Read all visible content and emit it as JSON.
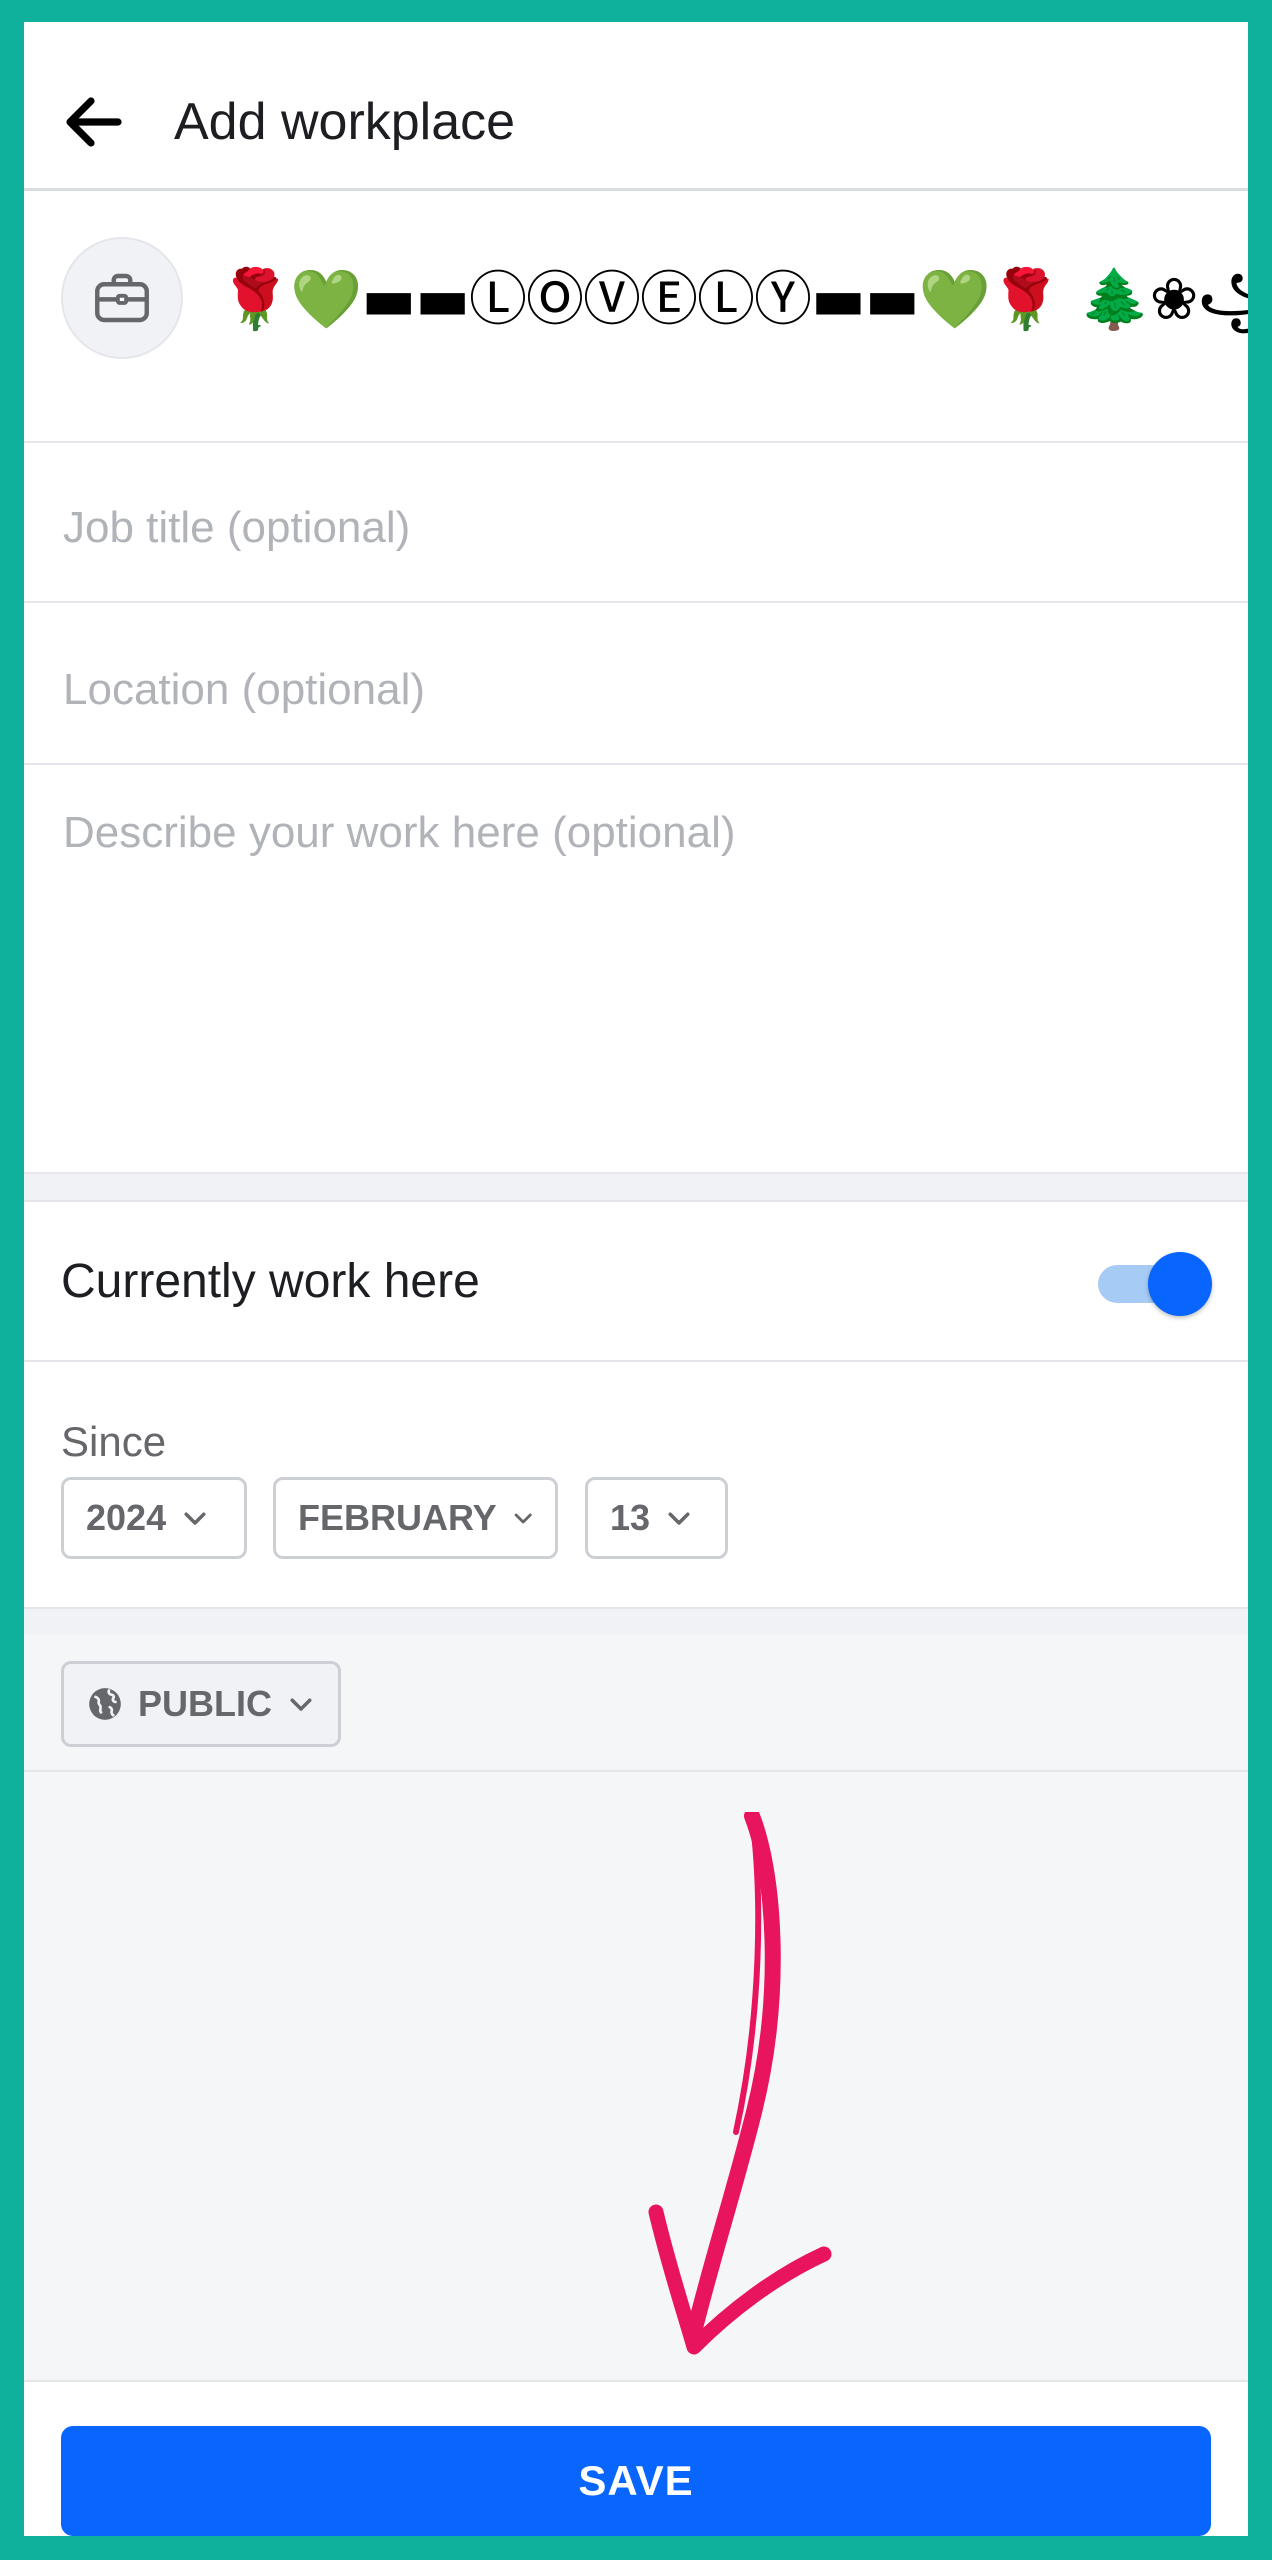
{
  "header": {
    "title": "Add workplace",
    "back_icon": "arrow-left-icon"
  },
  "company": {
    "icon": "briefcase-icon",
    "name": "🌹💚▬▬ⓁⓄⓋⒺⓁⓎ▬▬💚🌹 🌲❀꧁#ℕ𝕚𝕚𝕚ℂ𝕖꧂❀🌲🌹"
  },
  "fields": {
    "job_title_placeholder": "Job title (optional)",
    "location_placeholder": "Location (optional)",
    "description_placeholder": "Describe your work here (optional)"
  },
  "current": {
    "label": "Currently work here",
    "toggle_on": true
  },
  "since": {
    "label": "Since",
    "year": "2024",
    "month": "FEBRUARY",
    "day": "13"
  },
  "privacy": {
    "icon": "globe-icon",
    "label": "PUBLIC"
  },
  "save": {
    "label": "SAVE"
  },
  "colors": {
    "frame_border": "#0fb09c",
    "primary": "#0866ff",
    "toggle_track": "#a6ccf6",
    "annotation_arrow": "#e8145e"
  }
}
